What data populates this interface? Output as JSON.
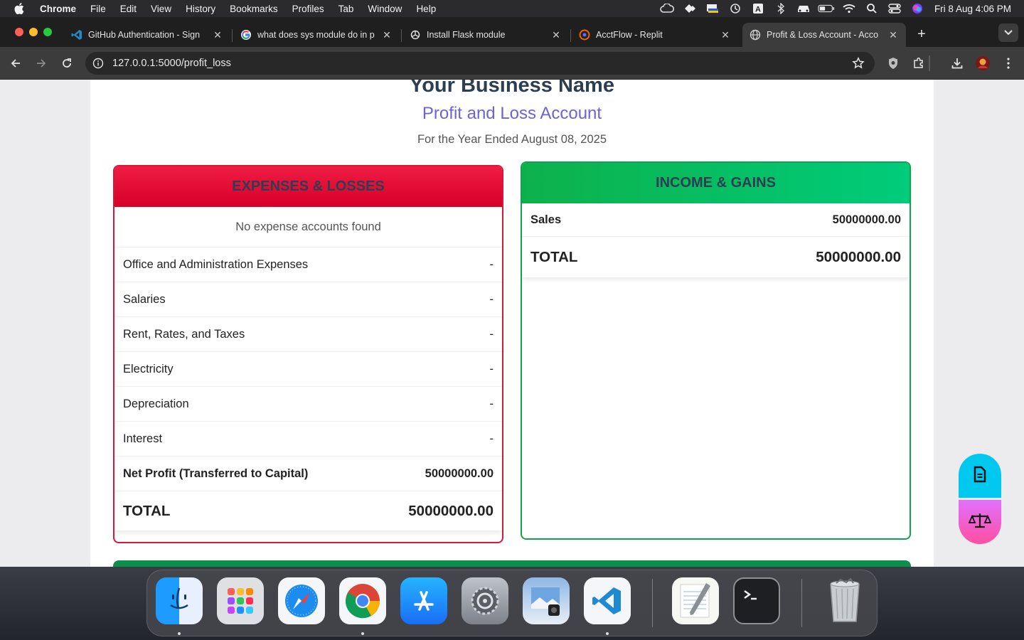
{
  "menubar": {
    "app_name": "Chrome",
    "menus": [
      "File",
      "Edit",
      "View",
      "History",
      "Bookmarks",
      "Profiles",
      "Tab",
      "Window",
      "Help"
    ],
    "clock": "Fri 8 Aug  4:06 PM"
  },
  "tabs": [
    {
      "title": "GitHub Authentication - Sign",
      "icon": "vscode-icon"
    },
    {
      "title": "what does sys module do in p",
      "icon": "google-icon"
    },
    {
      "title": "Install Flask module",
      "icon": "chatgpt-icon"
    },
    {
      "title": "AcctFlow - Replit",
      "icon": "replit-icon"
    },
    {
      "title": "Profit & Loss Account - Acco",
      "icon": "globe-icon",
      "active": true
    }
  ],
  "address_bar": {
    "url": "127.0.0.1:5000/profit_loss"
  },
  "report": {
    "business_name": "Your Business Name",
    "title": "Profit and Loss Account",
    "period": "For the Year Ended August 08, 2025"
  },
  "expenses": {
    "header": "EXPENSES & LOSSES",
    "empty_message": "No expense accounts found",
    "rows": [
      {
        "label": "Office and Administration Expenses",
        "value": "-"
      },
      {
        "label": "Salaries",
        "value": "-"
      },
      {
        "label": "Rent, Rates, and Taxes",
        "value": "-"
      },
      {
        "label": "Electricity",
        "value": "-"
      },
      {
        "label": "Depreciation",
        "value": "-"
      },
      {
        "label": "Interest",
        "value": "-"
      }
    ],
    "net_profit": {
      "label": "Net Profit (Transferred to Capital)",
      "value": "50000000.00"
    },
    "total": {
      "label": "TOTAL",
      "value": "50000000.00"
    }
  },
  "income": {
    "header": "INCOME & GAINS",
    "rows": [
      {
        "label": "Sales",
        "value": "50000000.00"
      }
    ],
    "total": {
      "label": "TOTAL",
      "value": "50000000.00"
    }
  },
  "dock": {
    "apps": [
      "Finder",
      "Launchpad",
      "Safari",
      "Chrome",
      "App Store",
      "System Settings",
      "Preview",
      "Visual Studio Code",
      "TextEdit",
      "Terminal",
      "Trash"
    ]
  },
  "colors": {
    "expense_header": "#e4002b",
    "income_header": "#00b050",
    "title_accent": "#6a64d8"
  }
}
